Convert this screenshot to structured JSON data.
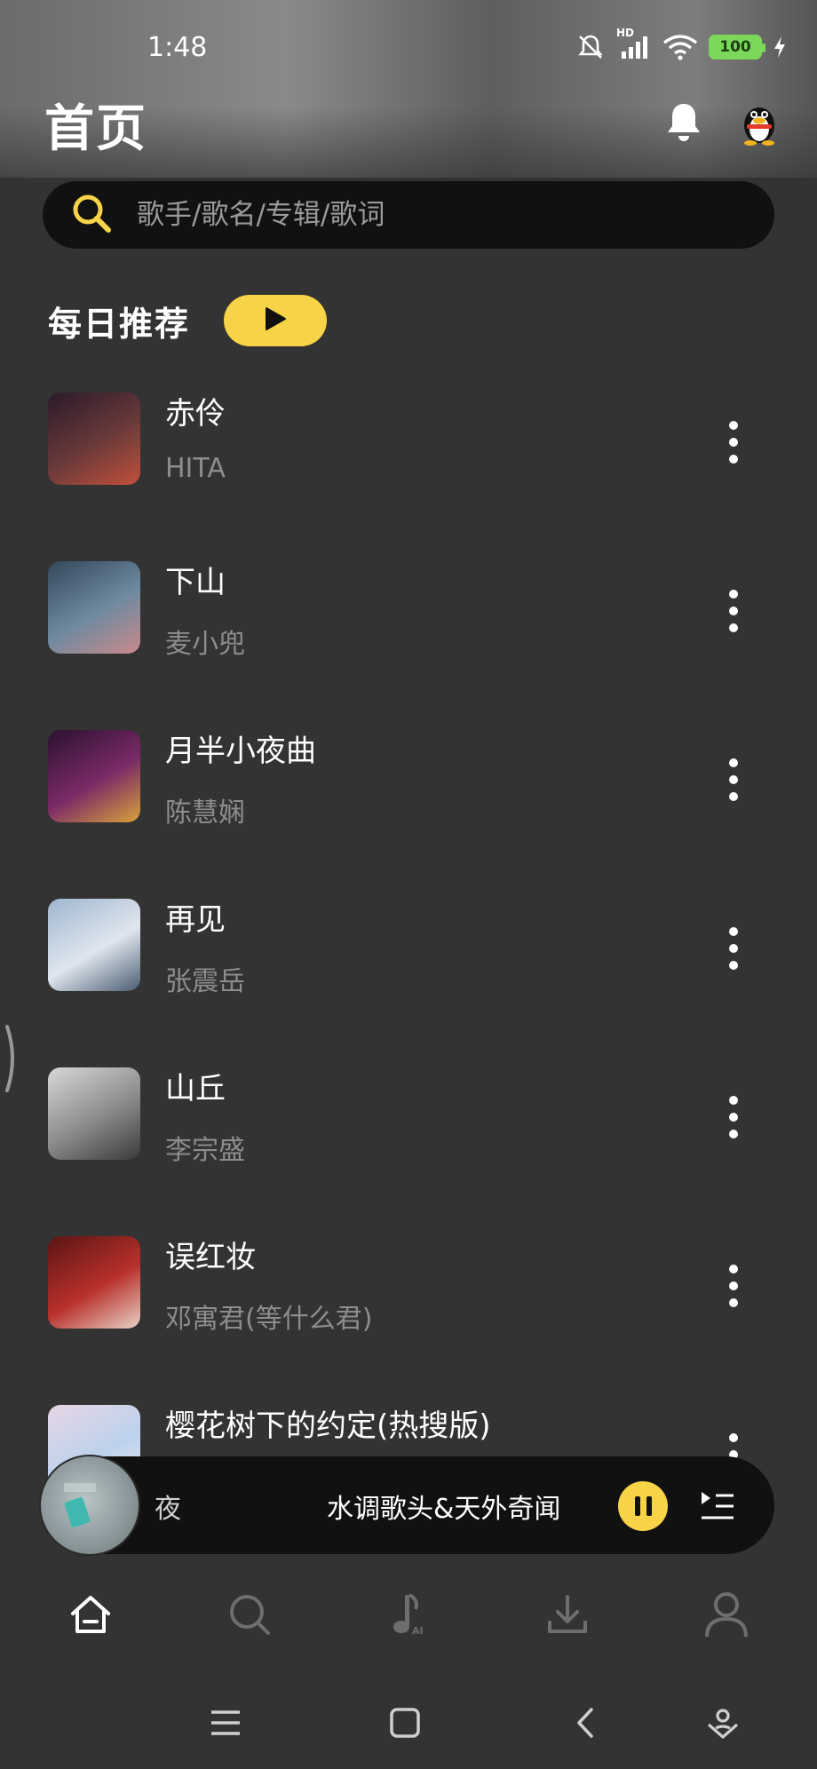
{
  "status": {
    "time": "1:48",
    "network": "HD",
    "battery": "100"
  },
  "header": {
    "title": "首页",
    "bell_icon": "bell-icon",
    "avatar_icon": "qq-penguin-avatar"
  },
  "search": {
    "placeholder": "歌手/歌名/专辑/歌词"
  },
  "daily": {
    "title": "每日推荐"
  },
  "songs": [
    {
      "title": "赤伶",
      "artist": "HITA",
      "cover_colors": [
        "#2a1a2a",
        "#6b3a3a",
        "#c2503a"
      ]
    },
    {
      "title": "下山",
      "artist": "麦小兜",
      "cover_colors": [
        "#34475a",
        "#6f8aa0",
        "#c98a8a"
      ]
    },
    {
      "title": "月半小夜曲",
      "artist": "陈慧娴",
      "cover_colors": [
        "#2b1230",
        "#7a2a66",
        "#d9a23a"
      ]
    },
    {
      "title": "再见",
      "artist": "张震岳",
      "cover_colors": [
        "#9fb6cf",
        "#dfe6ee",
        "#4a5c70"
      ]
    },
    {
      "title": "山丘",
      "artist": "李宗盛",
      "cover_colors": [
        "#d8d8d8",
        "#8a8a8a",
        "#3a3a3a"
      ]
    },
    {
      "title": "误红妆",
      "artist": "邓寓君(等什么君)",
      "cover_colors": [
        "#5a1515",
        "#b8302a",
        "#e8d2c8"
      ]
    },
    {
      "title": "樱花树下的约定(热搜版)",
      "artist": "",
      "cover_colors": [
        "#e7d6e6",
        "#bcd2ec",
        "#f2e8f0"
      ]
    }
  ],
  "mini_player": {
    "prev_text": "夜",
    "title": "水调歌头&天外奇闻"
  },
  "tabs": [
    {
      "name": "home",
      "icon": "home-icon",
      "active": true
    },
    {
      "name": "search",
      "icon": "search-icon",
      "active": false
    },
    {
      "name": "ai-music",
      "icon": "music-note-ai-icon",
      "active": false
    },
    {
      "name": "download",
      "icon": "download-icon",
      "active": false
    },
    {
      "name": "profile",
      "icon": "user-icon",
      "active": false
    }
  ],
  "colors": {
    "accent": "#f7d347",
    "background": "#333333",
    "bar": "#111111",
    "muted_text": "#8d8d8d"
  }
}
